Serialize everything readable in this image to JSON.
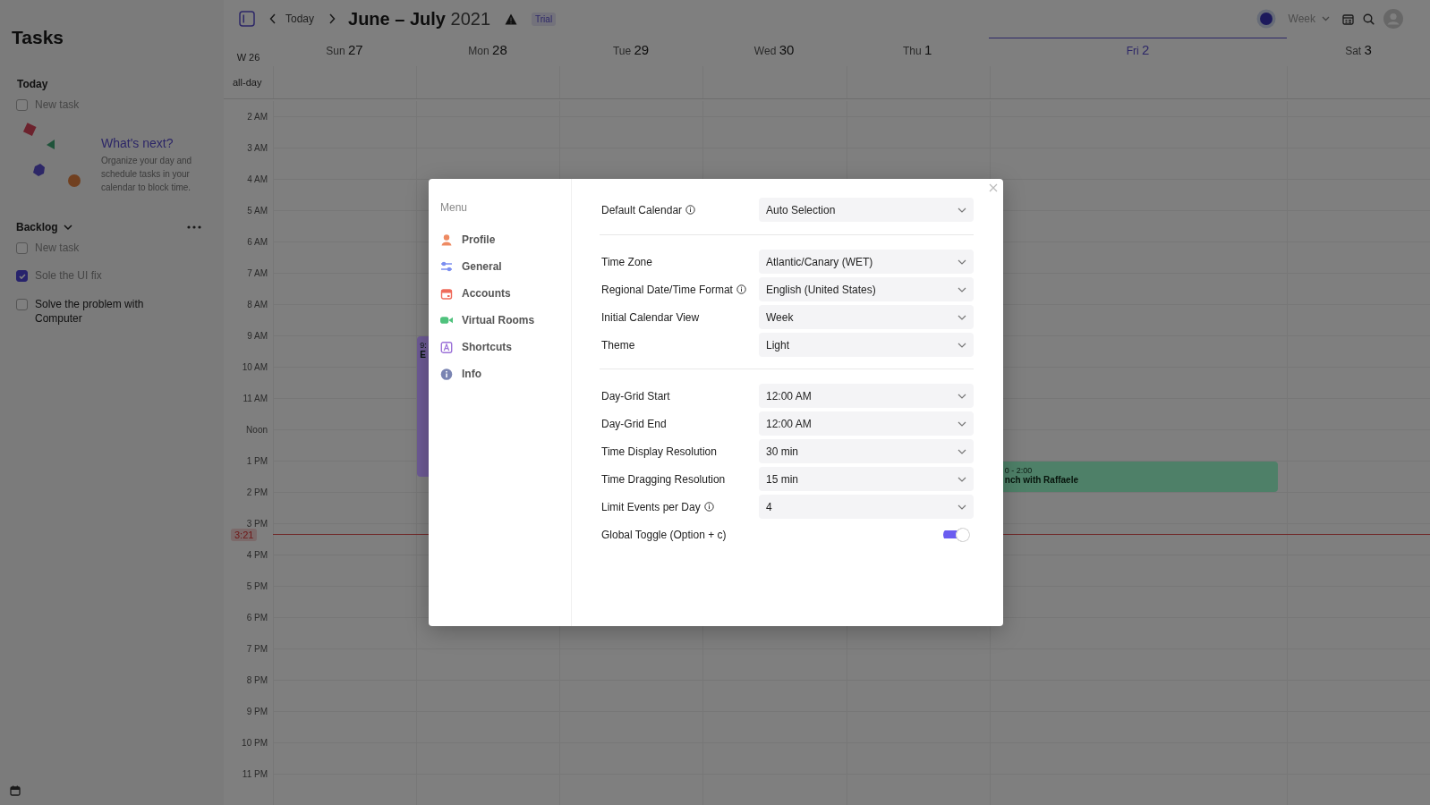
{
  "sidebar": {
    "title": "Tasks",
    "today": {
      "label": "Today",
      "new_task": {
        "placeholder": "New task",
        "checked": false
      }
    },
    "empty_state": {
      "heading": "What's next?",
      "text": "Organize your day and schedule tasks in your calendar to block time."
    },
    "backlog": {
      "label": "Backlog",
      "new_task": {
        "placeholder": "New task",
        "checked": false
      },
      "tasks": [
        {
          "text": "Sole the UI fix",
          "checked": true
        },
        {
          "text": "Solve the problem with Computer",
          "checked": false
        }
      ]
    }
  },
  "toolbar": {
    "today": "Today",
    "title": "**June – July** 2021",
    "badge": "Trial",
    "view": "Week"
  },
  "calendar": {
    "week": "W 26",
    "all_day": "all-day",
    "days": [
      {
        "weekday": "Sun",
        "day": "27",
        "selected": false
      },
      {
        "weekday": "Mon",
        "day": "28",
        "selected": false
      },
      {
        "weekday": "Tue",
        "day": "29",
        "selected": false
      },
      {
        "weekday": "Wed",
        "day": "30",
        "selected": false
      },
      {
        "weekday": "Thu",
        "day": "1",
        "selected": false
      },
      {
        "weekday": "Fri",
        "day": "2",
        "selected": true
      },
      {
        "weekday": "Sat",
        "day": "3",
        "selected": false
      }
    ],
    "hours": [
      "2 AM",
      "3 AM",
      "4 AM",
      "5 AM",
      "6 AM",
      "7 AM",
      "8 AM",
      "9 AM",
      "10 AM",
      "11 AM",
      "Noon",
      "1 PM",
      "2 PM",
      "3 PM",
      "4 PM",
      "5 PM",
      "6 PM",
      "7 PM",
      "8 PM",
      "9 PM",
      "10 PM",
      "11 PM"
    ],
    "now": "3:21",
    "events": [
      {
        "time": "9:",
        "title": "E",
        "color": "#6d5a95"
      },
      {
        "time": "0 - 2:00",
        "title": "nch with Raffaele",
        "color": "#4e8068"
      }
    ]
  },
  "settings": {
    "menu_label": "Menu",
    "menu": [
      "Profile",
      "General",
      "Accounts",
      "Virtual Rooms",
      "Shortcuts",
      "Info"
    ],
    "groups": [
      [
        {
          "label": "Default Calendar",
          "info": true,
          "kind": "select",
          "value": "Auto Selection"
        }
      ],
      [
        {
          "label": "Time Zone",
          "info": false,
          "kind": "select",
          "value": "Atlantic/Canary (WET)"
        },
        {
          "label": "Regional Date/Time Format",
          "info": true,
          "kind": "select",
          "value": "English (United States)"
        },
        {
          "label": "Initial Calendar View",
          "info": false,
          "kind": "select",
          "value": "Week"
        },
        {
          "label": "Theme",
          "info": false,
          "kind": "select",
          "value": "Light"
        }
      ],
      [
        {
          "label": "Day-Grid Start",
          "info": false,
          "kind": "select",
          "value": "12:00 AM"
        },
        {
          "label": "Day-Grid End",
          "info": false,
          "kind": "select",
          "value": "12:00 AM"
        },
        {
          "label": "Time Display Resolution",
          "info": false,
          "kind": "select",
          "value": "30 min"
        },
        {
          "label": "Time Dragging Resolution",
          "info": false,
          "kind": "select",
          "value": "15 min"
        },
        {
          "label": "Limit Events per Day",
          "info": true,
          "kind": "select",
          "value": "4"
        },
        {
          "label": "Global Toggle (Option + c)",
          "info": false,
          "kind": "toggle",
          "on": true
        }
      ]
    ]
  }
}
